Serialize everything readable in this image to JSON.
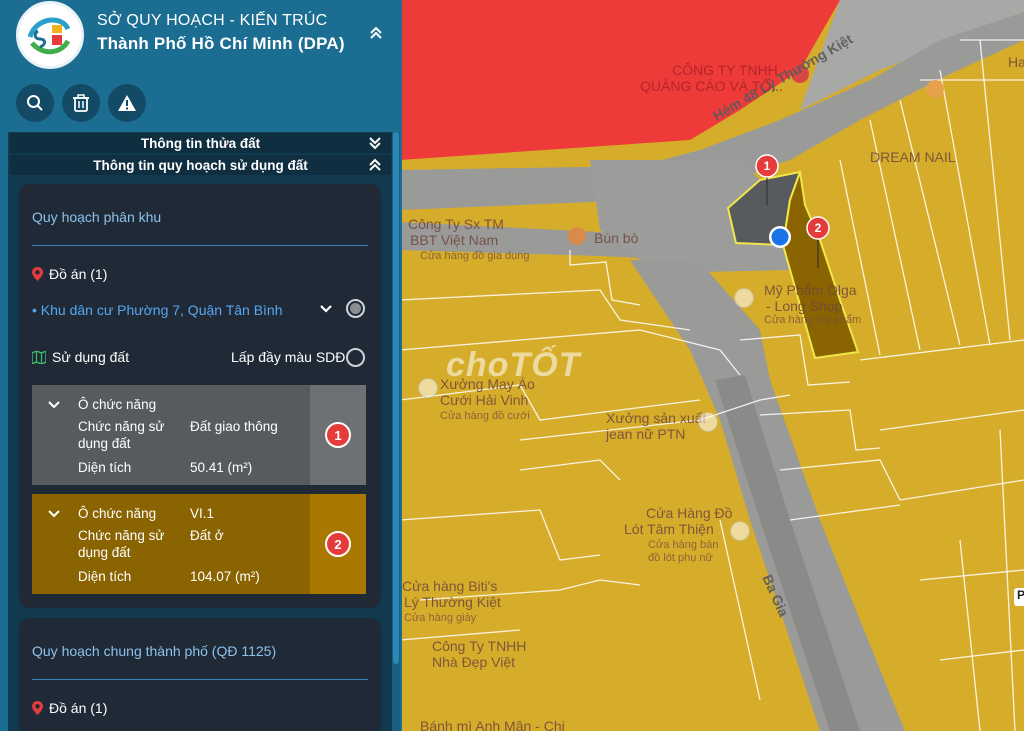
{
  "colors": {
    "panel_bg": "#1b6d92",
    "card_bg": "#202936",
    "accent_blue": "#56a8f0",
    "parcel_gray": "#585b5e",
    "parcel_gold": "#8a6400",
    "badge_red": "#e53b3b",
    "map_red_zone": "#ef3a3a",
    "map_yellow_zone": "#d6ad2a",
    "map_road": "#9a9a98"
  },
  "header": {
    "org_line1": "SỞ QUY HOẠCH - KIẾN TRÚC",
    "org_line2": "Thành Phố Hồ Chí Minh (DPA)",
    "collapse_icon": "double-chevron-up-icon"
  },
  "toolbar": {
    "buttons": [
      {
        "icon": "search-icon"
      },
      {
        "icon": "trash-icon"
      },
      {
        "icon": "warning-icon"
      }
    ]
  },
  "sections": {
    "parcel_info": "Thông tin thửa đất",
    "land_use_info": "Thông tin quy hoạch sử dụng đất"
  },
  "zoning_card": {
    "title": "Quy hoạch phân khu",
    "projects_label": "Đồ án (1)",
    "project_name": "• Khu dân cư Phường 7, Quận Tân Bình",
    "land_use_label": "Sử dụng đất",
    "fill_toggle_label": "Lấp đầy màu SDĐ"
  },
  "function_boxes": [
    {
      "heading": "Ô chức năng",
      "code": "",
      "use_label": "Chức năng sử dụng đất",
      "use_value": "Đất giao thông",
      "area_label": "Diện tích",
      "area_value": "50.41 (m²)",
      "badge": "1"
    },
    {
      "heading": "Ô chức năng",
      "code": "VI.1",
      "use_label": "Chức năng sử dụng đất",
      "use_value": "Đất ở",
      "area_label": "Diện tích",
      "area_value": "104.07 (m²)",
      "badge": "2"
    }
  ],
  "general_card": {
    "title": "Quy hoạch chung thành phố (QĐ 1125)",
    "projects_label": "Đồ án (1)"
  },
  "map": {
    "labels": {
      "company1_line1": "CÔNG TY TNHH",
      "company1_line2": "QUẢNG CÁO VÀ TỔ...",
      "hem": "Hẻm 48 Lý Thường Kiệt",
      "dream_nail": "DREAM NAIL",
      "bbt_line1": "Công Ty Sx TM",
      "bbt_line2": "BBT Việt Nam",
      "bbt_line3": "Cửa hàng đồ gia dụng",
      "bun_bo": "Bún bò",
      "my_pham_line1": "Mỹ Phẩm Olga",
      "my_pham_line2": "- Long Shop",
      "my_pham_line3": "Cửa hàng mỹ phẩm",
      "may_ao_line1": "Xưởng May Áo",
      "may_ao_line2": "Cưới Hải Vinh",
      "may_ao_line3": "Cửa hàng đồ cưới",
      "xuong_line1": "Xưởng sản xuất",
      "xuong_line2": "jean nữ PTN",
      "lot_line1": "Cửa Hàng Đồ",
      "lot_line2": "Lót Tâm Thiện",
      "lot_line3": "Cửa hàng bán",
      "lot_line4": "đồ lót phụ nữ",
      "bitis_line1": "Cửa hàng Biti's",
      "bitis_line2": "Lý Thường Kiệt",
      "bitis_line3": "Cửa hàng giày",
      "dep_line1": "Công Ty TNHH",
      "dep_line2": "Nhà Đẹp Việt",
      "anh_man": "Bánh mì Anh Mận - Chi",
      "ba_gia": "Ba Gia",
      "ha": "Ha",
      "edge": "P"
    },
    "watermark": "choTỐT",
    "markers": [
      "1",
      "2"
    ]
  }
}
